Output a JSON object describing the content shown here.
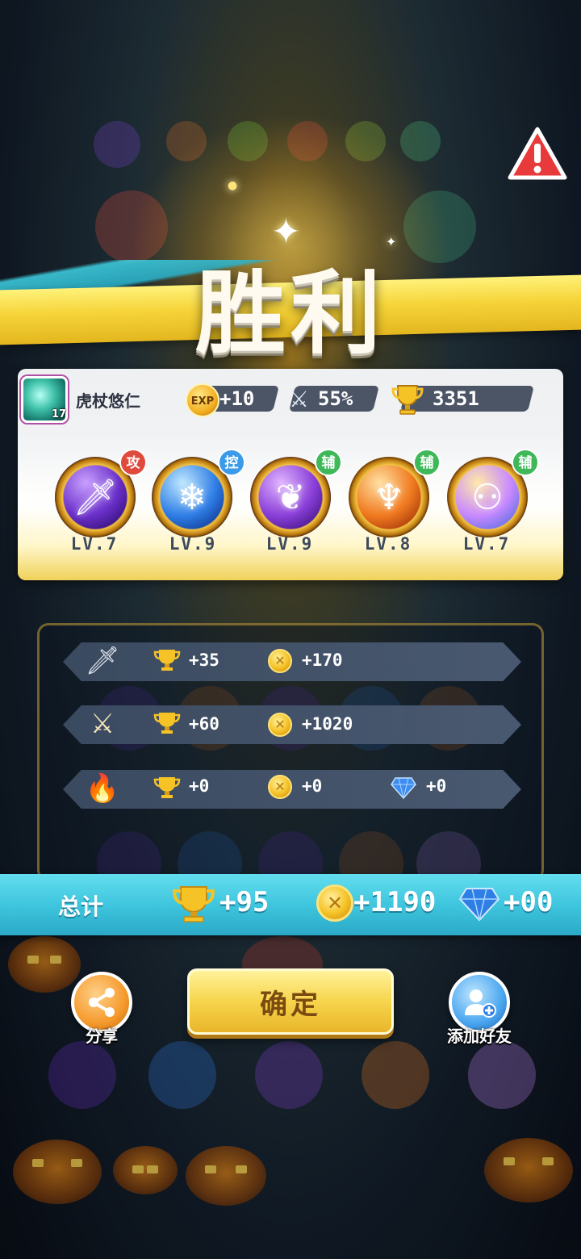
{
  "result_title": "胜利",
  "player": {
    "name": "虎杖悠仁",
    "avatar_level": "17",
    "exp_icon_label": "EXP",
    "exp": "+10",
    "win_rate": "55%",
    "trophies": "3351"
  },
  "skills": [
    {
      "badge": "攻",
      "badge_color": "#e04a3c",
      "level": "LV.7",
      "icon": "sword-icon",
      "colors": [
        "#c9a0ff",
        "#6a2fc9",
        "#2a0b6a"
      ]
    },
    {
      "badge": "控",
      "badge_color": "#3b9be8",
      "level": "LV.9",
      "icon": "snowflake-icon",
      "colors": [
        "#bfe8ff",
        "#2f7ee6",
        "#0c2f8a"
      ]
    },
    {
      "badge": "辅",
      "badge_color": "#3fb85a",
      "level": "LV.9",
      "icon": "leaf-icon",
      "colors": [
        "#e0b3ff",
        "#8a3fd8",
        "#3a0e7a"
      ]
    },
    {
      "badge": "辅",
      "badge_color": "#3fb85a",
      "level": "LV.8",
      "icon": "phoenix-icon",
      "colors": [
        "#ffe0a0",
        "#f07a20",
        "#9a2b08"
      ]
    },
    {
      "badge": "辅",
      "badge_color": "#3fb85a",
      "level": "LV.7",
      "icon": "figures-icon",
      "colors": [
        "#ffe8a8",
        "#c889ff",
        "#4d6bdf"
      ]
    }
  ],
  "rewards": [
    {
      "icon": "dagger-icon",
      "trophy": "+35",
      "coin": "+170"
    },
    {
      "icon": "crossed-swords-icon",
      "trophy": "+60",
      "coin": "+1020"
    },
    {
      "icon": "fire-icon",
      "trophy": "+0",
      "coin": "+0",
      "gem": "+0"
    }
  ],
  "total": {
    "label": "总计",
    "trophy": "+95",
    "coin": "+1190",
    "gem": "+00"
  },
  "buttons": {
    "share": "分享",
    "confirm": "确定",
    "add_friend": "添加好友"
  }
}
